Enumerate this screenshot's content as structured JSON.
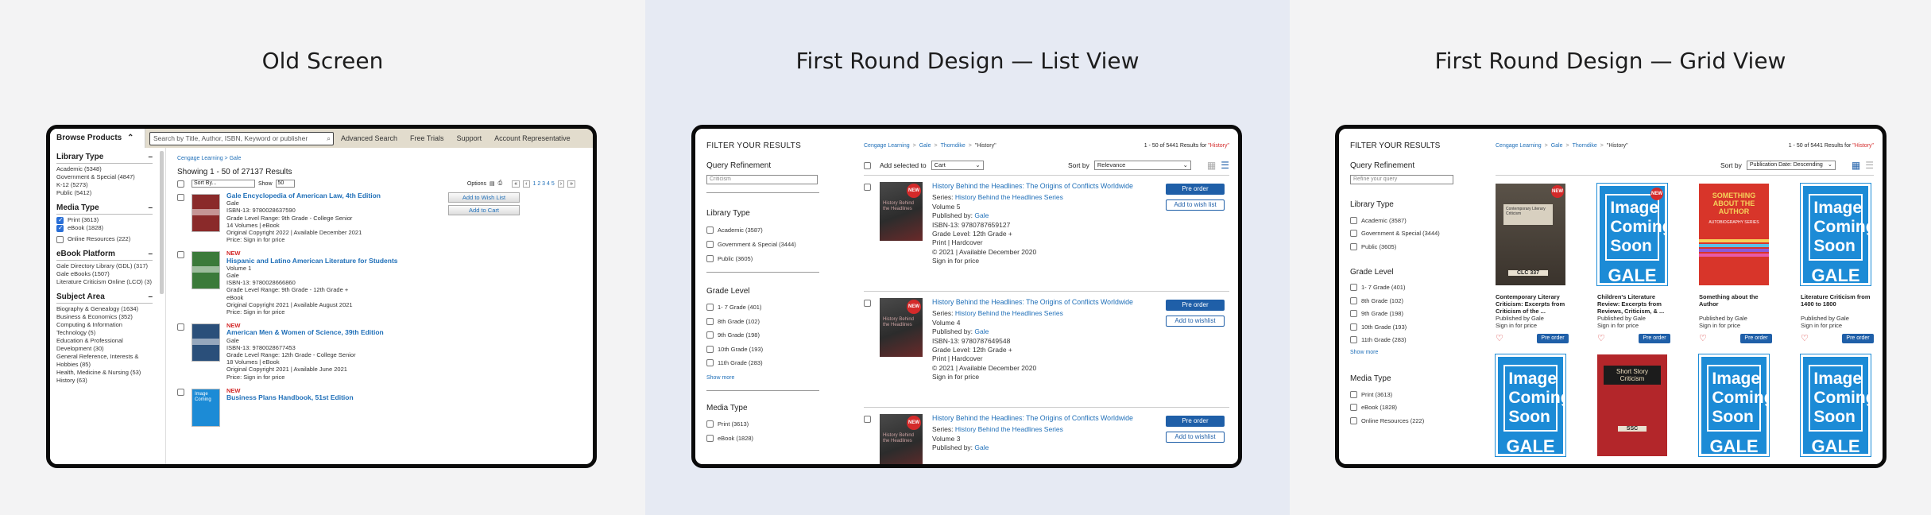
{
  "panels": {
    "old": "Old Screen",
    "list": "First Round Design — List View",
    "grid": "First Round Design — Grid View"
  },
  "old": {
    "browse": "Browse Products",
    "search_placeholder": "Search by Title, Author, ISBN, Keyword or publisher",
    "nav": [
      "Advanced Search",
      "Free Trials",
      "Support",
      "Account Representative"
    ],
    "breadcrumb": "Cengage Learning > Gale",
    "showing": "Showing 1 - 50 of 27137 Results",
    "sort": "Sort By...",
    "show_label": "Show",
    "show_val": "50",
    "options": "Options",
    "pager": "1 2 3 4 5",
    "facets": [
      {
        "title": "Library Type",
        "items": [
          "Academic (5348)",
          "Government & Special (4847)",
          "K-12 (5273)",
          "Public (5412)"
        ]
      },
      {
        "title": "Media Type",
        "items": [
          "Print (3613)",
          "eBook (1828)",
          "Online Resources (222)"
        ]
      },
      {
        "title": "eBook Platform",
        "items": [
          "Gale Directory Library (GDL) (317)",
          "Gale eBooks (1507)",
          "Literature Criticism Online (LCO) (3)"
        ]
      },
      {
        "title": "Subject Area",
        "items": [
          "Biography & Genealogy (1634)",
          "Business & Economics (352)",
          "Computing & Information Technology (5)",
          "Education & Professional Development (30)",
          "General Reference, Interests & Hobbies (85)",
          "Health, Medicine & Nursing (53)",
          "History (63)"
        ]
      }
    ],
    "wishlist": "Add to Wish List",
    "cart": "Add to Cart",
    "results": [
      {
        "new": "",
        "title": "Gale Encyclopedia of American Law, 4th Edition",
        "lines": [
          "Gale",
          "ISBN-13: 9780028637590",
          "Grade Level Range: 9th Grade - College Senior",
          "14 Volumes | eBook",
          "Original Copyright 2022 | Available December 2021",
          "Price: Sign in for price"
        ]
      },
      {
        "new": "NEW",
        "title": "Hispanic and Latino American Literature for Students",
        "lines": [
          "Volume 1",
          "Gale",
          "ISBN-13: 9780028666860",
          "Grade Level Range: 9th Grade - 12th Grade +",
          "eBook",
          "Original Copyright 2021 | Available August 2021",
          "Price: Sign in for price"
        ]
      },
      {
        "new": "NEW",
        "title": "American Men & Women of Science, 39th Edition",
        "lines": [
          "Gale",
          "ISBN-13: 9780028677453",
          "Grade Level Range: 12th Grade - College Senior",
          "18 Volumes | eBook",
          "Original Copyright 2021 | Available June 2021",
          "Price: Sign in for price"
        ]
      },
      {
        "new": "NEW",
        "title": "Business Plans Handbook, 51st Edition",
        "lines": []
      }
    ],
    "image_label": "Image Coming"
  },
  "list": {
    "filter_title": "FILTER YOUR RESULTS",
    "query_title": "Query Refinement",
    "query_placeholder": "Criticism",
    "library_title": "Library Type",
    "library": [
      "Academic (3587)",
      "Government & Special (3444)",
      "Public (3605)"
    ],
    "grade_title": "Grade Level",
    "grade": [
      "1- 7 Grade (401)",
      "8th Grade (102)",
      "9th Grade (198)",
      "10th Grade (193)",
      "11th Grade (283)"
    ],
    "show_more": "Show more",
    "media_title": "Media Type",
    "media": [
      "Print (3613)",
      "eBook (1828)"
    ],
    "crumbs": [
      "Cengage Learning",
      "Gale",
      "Thorndike",
      "\"History\""
    ],
    "count": "1 - 50 of 5441 Results for ",
    "query": "\"History\"",
    "add_selected": "Add selected to",
    "cart_sel": "Cart",
    "sort_label": "Sort by",
    "sort_val": "Relevance",
    "preorder": "Pre order",
    "wish1": "Add to wish list",
    "wish2": "Add to wishlist",
    "items": [
      {
        "title": "History Behind the Headlines: The Origins of Conflicts Worldwide",
        "series_label": "Series: ",
        "series": "History Behind the Headlines Series",
        "vol": "Volume 5",
        "pub_label": "Published by: ",
        "pub": "Gale",
        "lines": [
          "ISBN-13: 9780787659127",
          "Grade Level: 12th Grade +",
          "Print | Hardcover",
          "© 2021 | Available December 2020",
          "Sign in for price"
        ]
      },
      {
        "title": "History Behind the Headlines: The Origins of Conflicts Worldwide",
        "series_label": "Series: ",
        "series": "History Behind the Headlines Series",
        "vol": "Volume 4",
        "pub_label": "Published by: ",
        "pub": "Gale",
        "lines": [
          "ISBN-13: 9780787649548",
          "Grade Level: 12th Grade +",
          "Print | Hardcover",
          "© 2021 | Available December 2020",
          "Sign in for price"
        ]
      },
      {
        "title": "History Behind the Headlines: The Origins of Conflicts Worldwide",
        "series_label": "Series: ",
        "series": "History Behind the Headlines Series",
        "vol": "Volume 3",
        "pub_label": "Published by: ",
        "pub": "Gale",
        "lines": []
      }
    ],
    "cover_text": "History Behind the Headlines",
    "new": "NEW"
  },
  "grid": {
    "filter_title": "FILTER YOUR RESULTS",
    "query_title": "Query Refinement",
    "query_placeholder": "Refine your query",
    "library_title": "Library Type",
    "library": [
      "Academic (3587)",
      "Government & Special (3444)",
      "Public (3605)"
    ],
    "grade_title": "Grade Level",
    "grade": [
      "1- 7 Grade (401)",
      "8th Grade (102)",
      "9th Grade (198)",
      "10th Grade (193)",
      "11th Grade (283)"
    ],
    "show_more": "Show more",
    "media_title": "Media Type",
    "media": [
      "Print (3613)",
      "eBook (1828)",
      "Online Resources (222)"
    ],
    "crumbs": [
      "Cengage Learning",
      "Gale",
      "Thorndike",
      "\"History\""
    ],
    "count": "1 - 50 of 5441 Results for ",
    "query": "\"History\"",
    "sort_label": "Sort by",
    "sort_val": "Publication Date: Descending",
    "preorder": "Pre order",
    "image_coming": "Image Coming Soon",
    "gale": "GALE",
    "gale_sub": "A Cengage Company",
    "new": "NEW",
    "cards": [
      {
        "title": "Contemporary Literary Criticism: Excerpts from Criticism of the ...",
        "pub": "Published by Gale",
        "price": "Sign in for price",
        "cover": "dark"
      },
      {
        "title": "Children's Literature Review: Excerpts from Reviews, Criticism, & ...",
        "pub": "Published by Gale",
        "price": "Sign in for price",
        "cover": "gale"
      },
      {
        "title": "Something about the Author",
        "pub": "Published by Gale",
        "price": "Sign in for price",
        "cover": "red"
      },
      {
        "title": "Literature Criticism from 1400 to 1800",
        "pub": "Published by Gale",
        "price": "Sign in for price",
        "cover": "gale"
      }
    ],
    "dark_cover_text": "Contemporary Literary Criticism",
    "dark_cover_code": "CLC 337",
    "red_cover_text": "SOMETHING ABOUT THE AUTHOR",
    "red_cover_sub": "AUTOBIOGRAPHY SERIES",
    "ssc_text": "Short Story Criticism",
    "ssc_code": "SSC"
  }
}
